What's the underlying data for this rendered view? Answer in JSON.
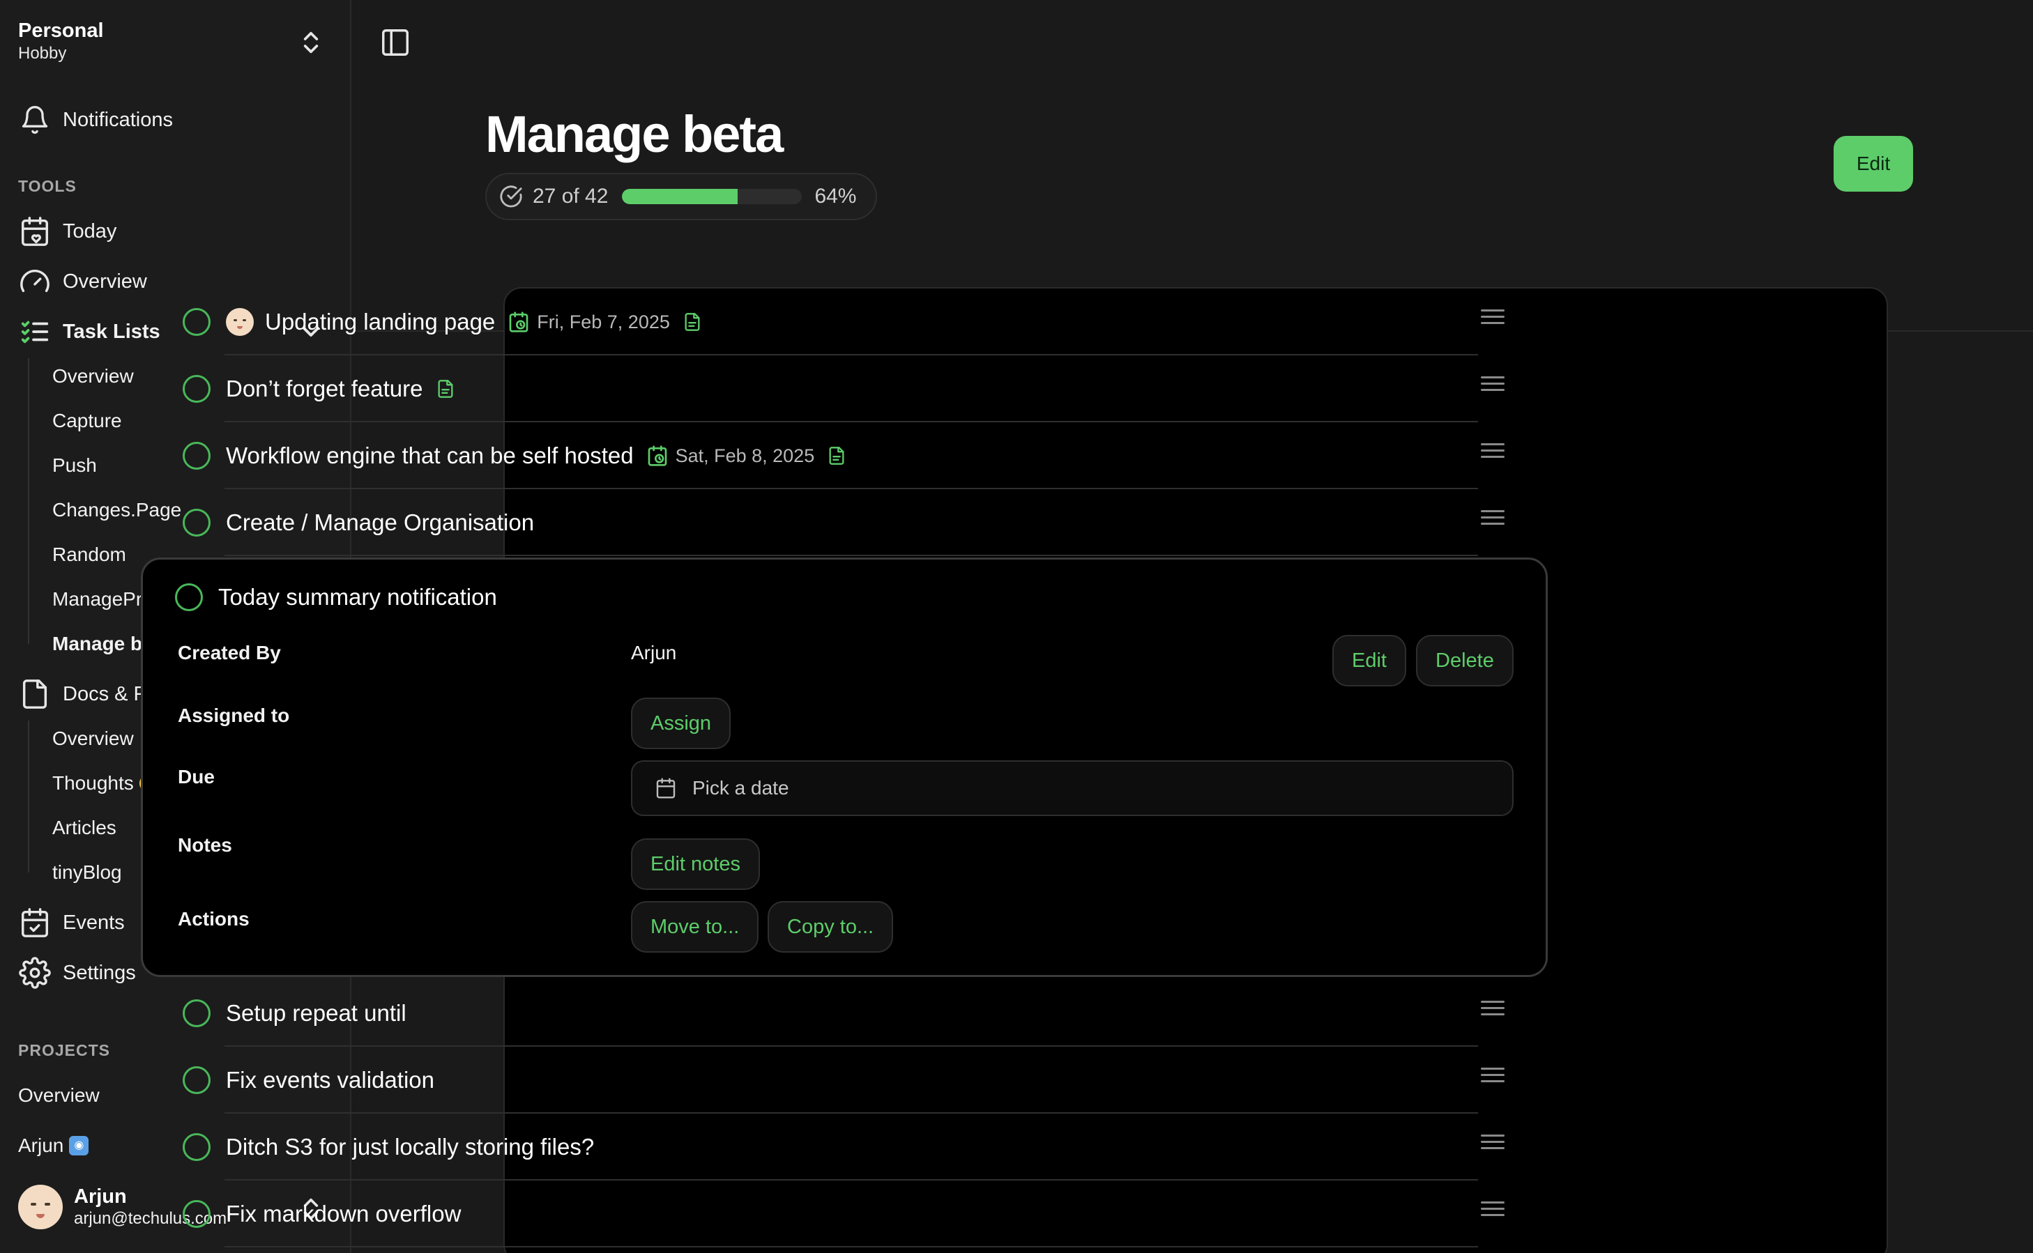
{
  "workspace": {
    "name": "Personal",
    "plan": "Hobby"
  },
  "nav": {
    "notifications": "Notifications",
    "tools_title": "TOOLS",
    "today": "Today",
    "overview": "Overview",
    "task_lists": "Task Lists",
    "task_list_items": [
      "Overview",
      "Capture",
      "Push",
      "Changes.Page",
      "Random",
      "ManagePrompt",
      "Manage beta"
    ],
    "docs_files": "Docs & Files",
    "docs_items": [
      "Overview",
      "Thoughts",
      "Articles",
      "tinyBlog"
    ],
    "events": "Events",
    "settings": "Settings",
    "projects_title": "PROJECTS",
    "projects": [
      "Overview",
      "Arjun"
    ]
  },
  "user": {
    "name": "Arjun",
    "email": "arjun@techulus.com"
  },
  "page": {
    "title": "Manage beta",
    "progress_text": "27 of 42",
    "progress_fraction": 0.64,
    "progress_percent": "64%",
    "edit_label": "Edit"
  },
  "tasks_before": [
    {
      "title": "Updating landing page",
      "date": "Fri, Feb 7, 2025",
      "has_avatar": true,
      "has_doc": true
    },
    {
      "title": "Don’t forget feature",
      "date": "",
      "has_avatar": false,
      "has_doc": true
    },
    {
      "title": "Workflow engine that can be self hosted",
      "date": "Sat, Feb 8, 2025",
      "has_avatar": false,
      "has_doc": true
    },
    {
      "title": "Create / Manage Organisation",
      "date": "",
      "has_avatar": false,
      "has_doc": false
    }
  ],
  "expanded_task": {
    "title": "Today summary notification",
    "created_by_label": "Created By",
    "created_by_value": "Arjun",
    "assigned_label": "Assigned to",
    "assign_button": "Assign",
    "due_label": "Due",
    "due_placeholder": "Pick a date",
    "notes_label": "Notes",
    "edit_notes_button": "Edit notes",
    "actions_label": "Actions",
    "move_button": "Move to...",
    "copy_button": "Copy to...",
    "edit_button": "Edit",
    "delete_button": "Delete"
  },
  "tasks_after": [
    {
      "title": "Setup repeat until"
    },
    {
      "title": "Fix events validation"
    },
    {
      "title": "Ditch S3 for just locally storing files?"
    },
    {
      "title": "Fix markdown overflow"
    }
  ],
  "colors": {
    "accent": "#5dcd6a",
    "background": "#1a1a1a",
    "card": "#000000"
  },
  "icons": [
    "chevrons-up-down-icon",
    "bell-icon",
    "calendar-heart-icon",
    "gauge-icon",
    "list-checks-icon",
    "chevron-down-icon",
    "file-icon",
    "calendar-check-icon",
    "gear-icon",
    "panel-left-icon",
    "circle-check-icon",
    "alarm-clock-icon",
    "calendar-icon",
    "drag-handle-icon"
  ]
}
